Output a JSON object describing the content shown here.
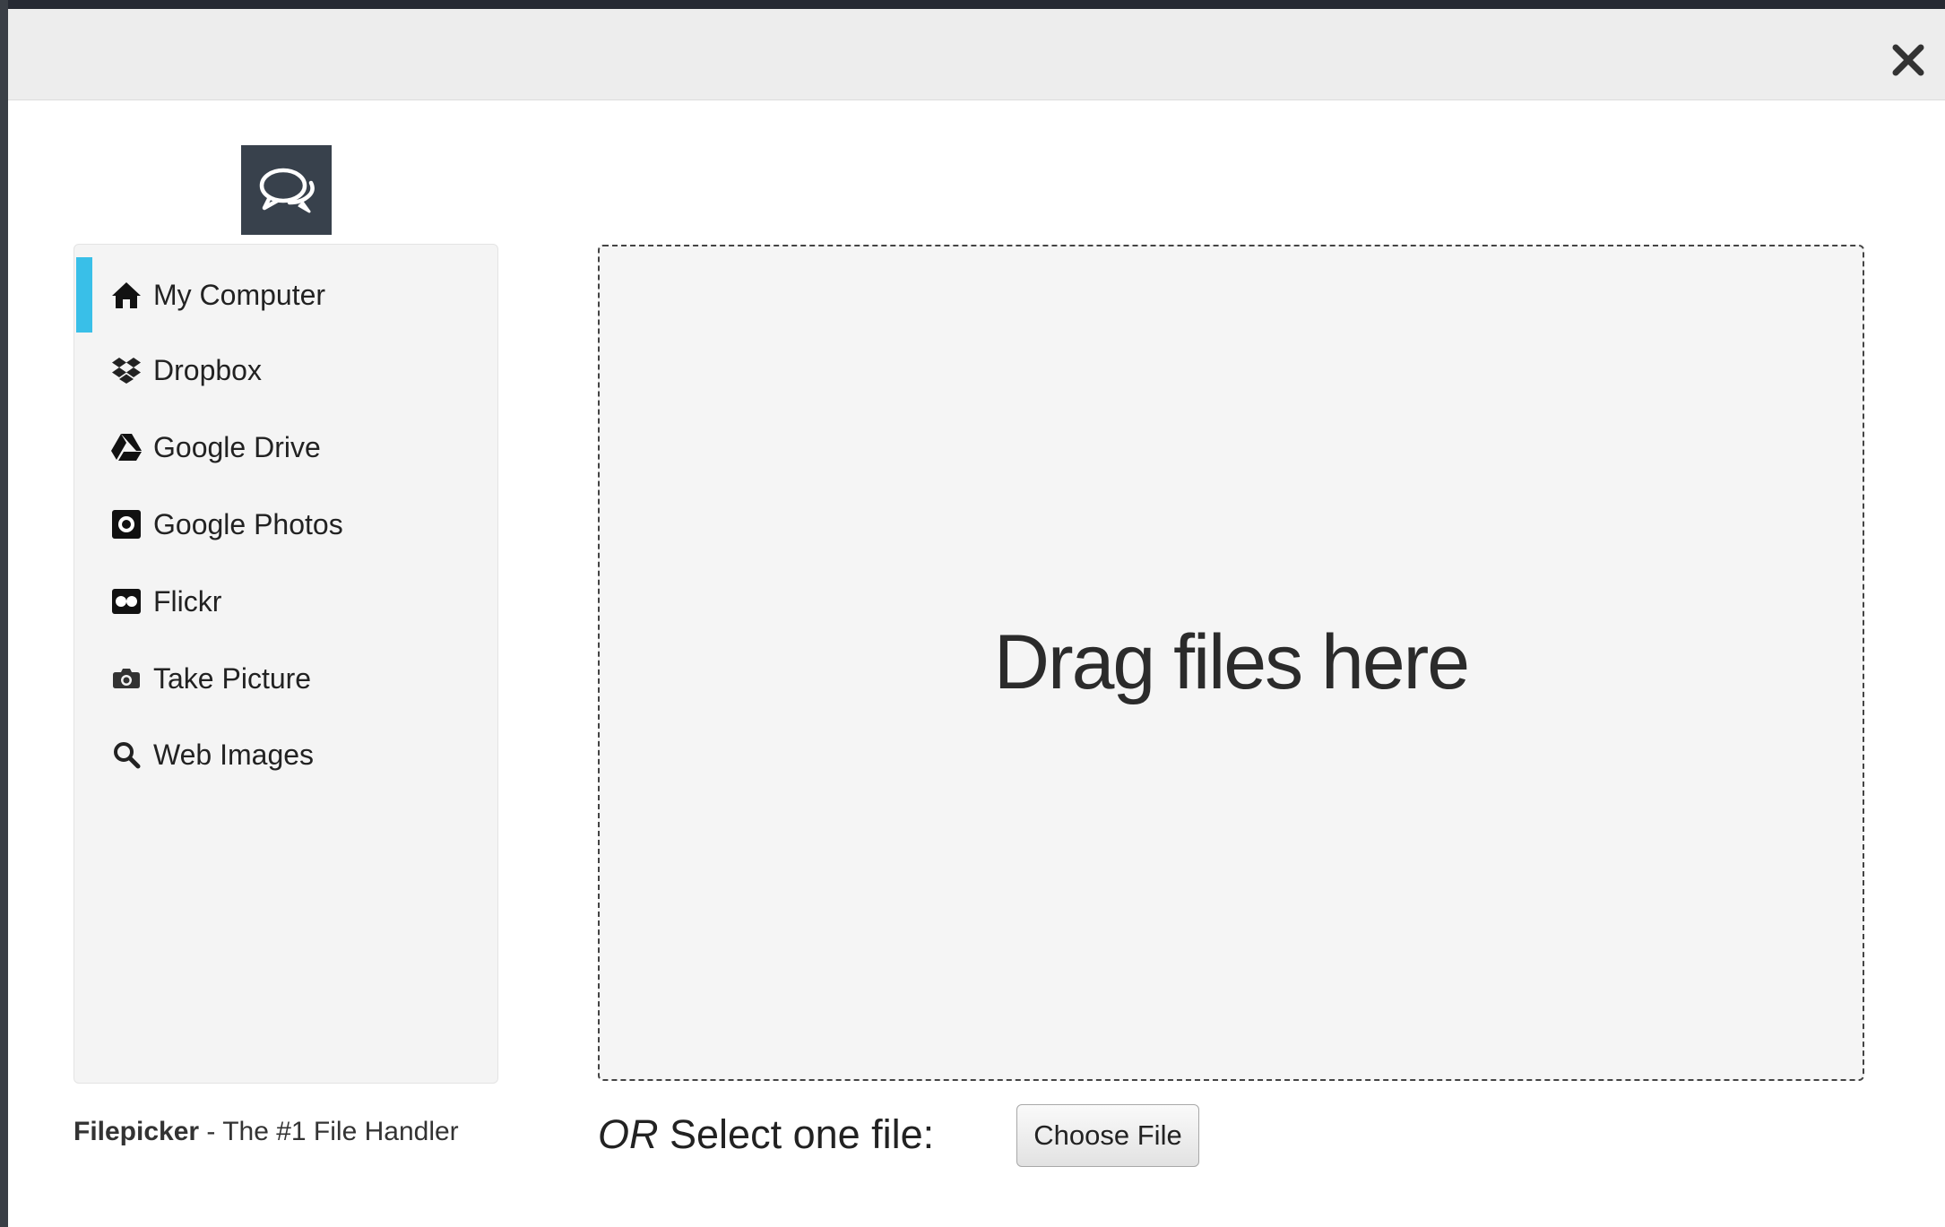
{
  "window": {
    "close_icon": "close-icon"
  },
  "logo": {
    "icon": "chat-bubbles-icon",
    "bg_color": "#38414c"
  },
  "sidebar": {
    "accent_color": "#39bfe8",
    "items": [
      {
        "label": "My Computer",
        "icon": "home-icon",
        "active": true
      },
      {
        "label": "Dropbox",
        "icon": "dropbox-icon",
        "active": false
      },
      {
        "label": "Google Drive",
        "icon": "google-drive-icon",
        "active": false
      },
      {
        "label": "Google Photos",
        "icon": "google-photos-icon",
        "active": false
      },
      {
        "label": "Flickr",
        "icon": "flickr-icon",
        "active": false
      },
      {
        "label": "Take Picture",
        "icon": "camera-icon",
        "active": false
      },
      {
        "label": "Web Images",
        "icon": "search-icon",
        "active": false
      }
    ]
  },
  "footer": {
    "brand": "Filepicker",
    "tagline": " - The #1 File Handler"
  },
  "dropzone": {
    "text": "Drag files here"
  },
  "select": {
    "or_text": "OR",
    "label": " Select one file:",
    "button_label": "Choose File"
  }
}
